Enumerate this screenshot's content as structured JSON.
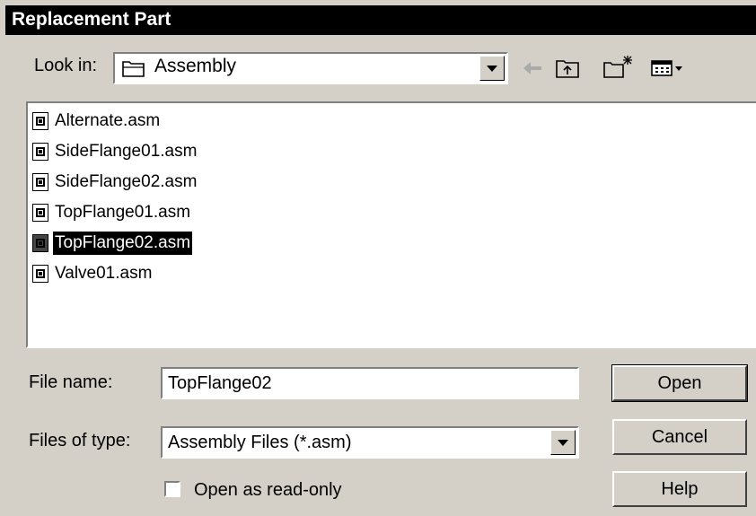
{
  "window": {
    "title": "Replacement Part"
  },
  "lookin": {
    "label": "Look in:",
    "value": "Assembly"
  },
  "toolbar": {
    "back": "back-icon",
    "up_folder": "up-one-level-icon",
    "new_folder": "new-folder-icon",
    "view_menu": "view-menu-icon"
  },
  "files": [
    {
      "name": "Alternate.asm",
      "selected": false
    },
    {
      "name": "SideFlange01.asm",
      "selected": false
    },
    {
      "name": "SideFlange02.asm",
      "selected": false
    },
    {
      "name": "TopFlange01.asm",
      "selected": false
    },
    {
      "name": "TopFlange02.asm",
      "selected": true
    },
    {
      "name": "Valve01.asm",
      "selected": false
    }
  ],
  "filename": {
    "label": "File name:",
    "value": "TopFlange02"
  },
  "filetype": {
    "label": "Files of type:",
    "value": "Assembly Files (*.asm)"
  },
  "readonly": {
    "label": "Open as read-only",
    "checked": false
  },
  "buttons": {
    "open": "Open",
    "cancel": "Cancel",
    "help": "Help"
  }
}
